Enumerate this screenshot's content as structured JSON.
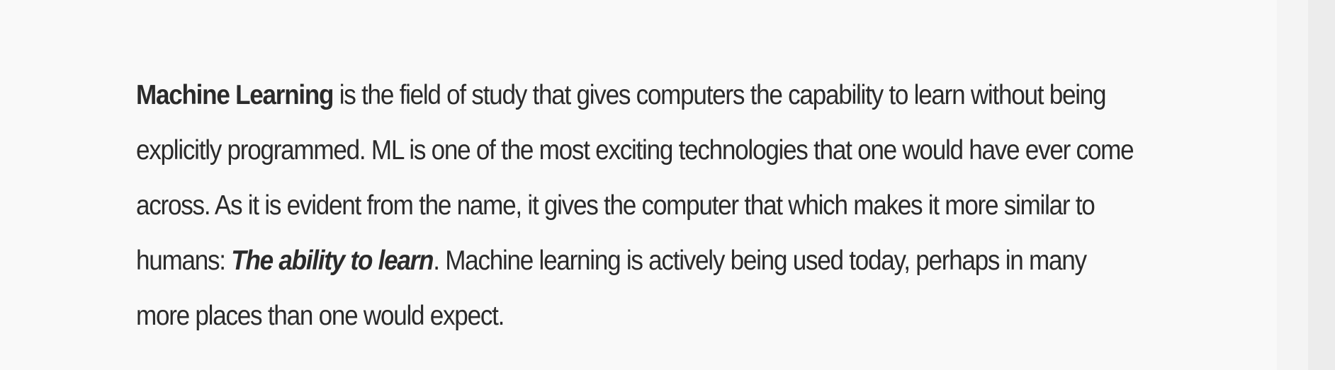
{
  "article": {
    "term": "Machine Learning",
    "text_1": " is the field of study that gives computers the capability to learn without being explicitly programmed. ML is one of the most exciting technologies that one would have ever come across. As it is evident from the name, it gives the computer that which makes it more similar to humans: ",
    "emphasis": "The ability to learn",
    "text_2": ". Machine learning is actively being used today, perhaps in many more places than one would expect."
  }
}
